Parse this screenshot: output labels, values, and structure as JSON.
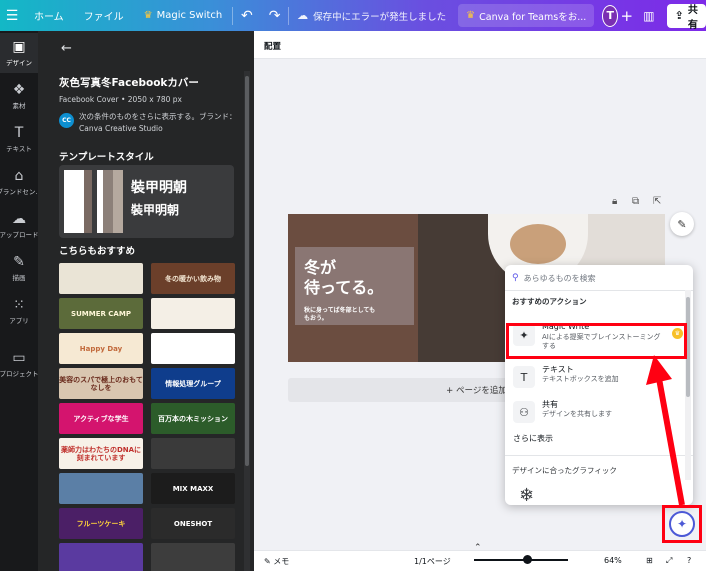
{
  "topbar": {
    "home": "ホーム",
    "file": "ファイル",
    "magic_switch": "Magic Switch",
    "status": "保存中にエラーが発生しました",
    "teams": "Canva for Teamsをお...",
    "avatar": "T",
    "share": "共有"
  },
  "rail": [
    {
      "label": "デザイン",
      "icon": "layout-icon"
    },
    {
      "label": "素材",
      "icon": "elements-icon"
    },
    {
      "label": "テキスト",
      "icon": "text-icon"
    },
    {
      "label": "ブランドセン...",
      "icon": "brand-icon"
    },
    {
      "label": "アップロード",
      "icon": "upload-icon"
    },
    {
      "label": "描画",
      "icon": "draw-icon"
    },
    {
      "label": "アプリ",
      "icon": "apps-icon"
    },
    {
      "label": "プロジェクト",
      "icon": "folder-icon"
    }
  ],
  "panel": {
    "title": "灰色写真冬Facebookカバー",
    "subtitle": "Facebook Cover • 2050 x 780 px",
    "brand_logo": "CC",
    "brand_text": "次の条件のものをさらに表示する。ブランド：Canva Creative Studio",
    "style_heading": "テンプレートスタイル",
    "style_font_big": "裝甲明朝",
    "style_font_small": "裝甲明朝",
    "recommend_heading": "こちらもおすすめ",
    "thumbs": [
      {
        "text": "",
        "bg": "#eae4d6",
        "fg": "#8a7c5c"
      },
      {
        "text": "冬の暖かい飲み物",
        "bg": "#6b3f2a",
        "fg": "#f3e6d2"
      },
      {
        "text": "SUMMER CAMP",
        "bg": "#5c6b3a",
        "fg": "#fff7d8"
      },
      {
        "text": "",
        "bg": "#f4efe6",
        "fg": "#555"
      },
      {
        "text": "Happy Day",
        "bg": "#f6e9d3",
        "fg": "#c26a3c"
      },
      {
        "text": "",
        "bg": "#ffffff",
        "fg": "#3a86d6"
      },
      {
        "text": "美容のスパで極上のおもてなしを",
        "bg": "#d9c6b0",
        "fg": "#6b2c1e"
      },
      {
        "text": "情報処理グループ",
        "bg": "#0f3d8c",
        "fg": "#ffffff"
      },
      {
        "text": "アクティブな学生",
        "bg": "#d4146e",
        "fg": "#ffffff"
      },
      {
        "text": "百万本の木ミッション",
        "bg": "#2c5c2a",
        "fg": "#ffffff"
      },
      {
        "text": "薬師力はわたちのDNAに刻まれています",
        "bg": "#f7f1e8",
        "fg": "#c0302c"
      },
      {
        "text": "",
        "bg": "#3a3a3a",
        "fg": "#fff"
      },
      {
        "text": "",
        "bg": "#5b7fa6",
        "fg": "#fff"
      },
      {
        "text": "MIX MAXX",
        "bg": "#1c1c1c",
        "fg": "#ffffff"
      },
      {
        "text": "フルーツケーキ",
        "bg": "#4b1f66",
        "fg": "#ffd33a"
      },
      {
        "text": "ONESHOT",
        "bg": "#2b2b2b",
        "fg": "#ffffff"
      },
      {
        "text": "",
        "bg": "#5a3aa0",
        "fg": "#f4d04a"
      },
      {
        "text": "",
        "bg": "#3d3d3d",
        "fg": "#fff"
      }
    ]
  },
  "canvas": {
    "label": "配置",
    "design_title": "冬が\n待ってる。",
    "design_sub": "秋に身ってば冬部としても\nもおう。",
    "add_page": "+ ページを追加"
  },
  "popup": {
    "search_placeholder": "あらゆるものを検索",
    "recommended_heading": "おすすめのアクション",
    "actions": [
      {
        "title": "Magic Write™",
        "desc": "AIによる提案でブレインストーミングする",
        "icon": "magic-wand-icon"
      },
      {
        "title": "テキスト",
        "desc": "テキストボックスを追加",
        "icon": "text-icon"
      },
      {
        "title": "共有",
        "desc": "デザインを共有します",
        "icon": "share-people-icon"
      }
    ],
    "more": "さらに表示",
    "graphics_heading": "デザインに合ったグラフィック"
  },
  "bottombar": {
    "memo": "メモ",
    "pages": "1/1ページ",
    "zoom": "64%"
  },
  "colors": {
    "highlight": "#ff0012",
    "accent": "#4c59d6"
  }
}
